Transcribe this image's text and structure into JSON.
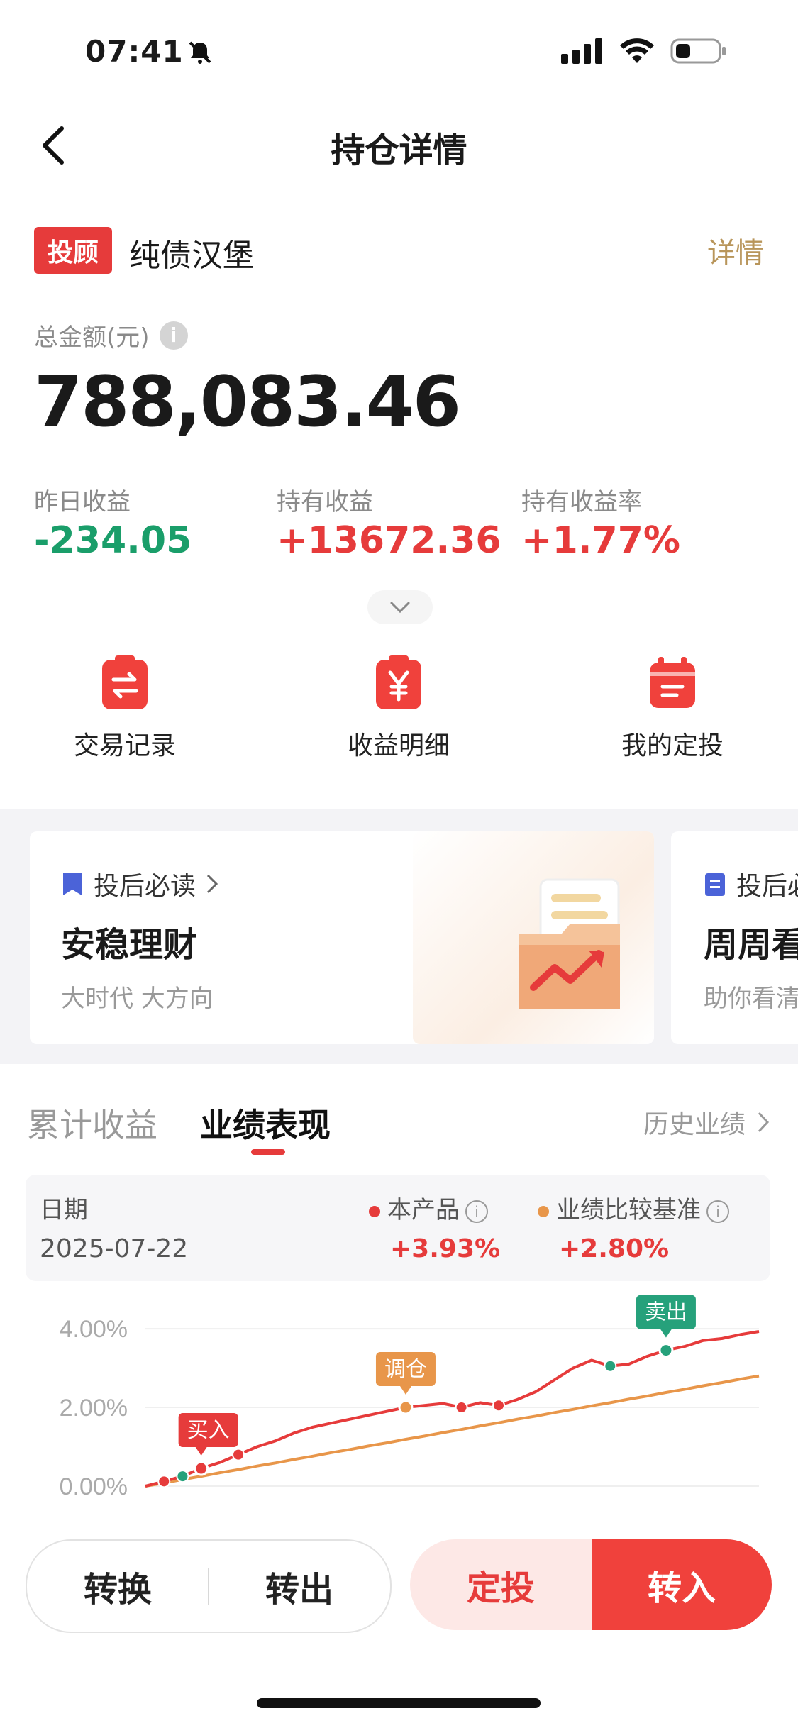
{
  "status_bar": {
    "time": "07:41"
  },
  "nav": {
    "title": "持仓详情"
  },
  "product": {
    "tag": "投顾",
    "name": "纯债汉堡",
    "detail_link": "详情"
  },
  "summary": {
    "total_label": "总金额(元)",
    "total_value": "788,083.46",
    "metrics": [
      {
        "label": "昨日收益",
        "value": "-234.05",
        "color": "#1a9e6a"
      },
      {
        "label": "持有收益",
        "value": "+13672.36",
        "color": "#e63b3b"
      },
      {
        "label": "持有收益率",
        "value": "+1.77%",
        "color": "#e63b3b"
      }
    ]
  },
  "quick_actions": [
    {
      "label": "交易记录",
      "icon": "exchange-icon"
    },
    {
      "label": "收益明细",
      "icon": "yuan-receipt-icon"
    },
    {
      "label": "我的定投",
      "icon": "calendar-icon"
    }
  ],
  "cards": [
    {
      "header": "投后必读",
      "title": "安稳理财",
      "subtitle": "大时代 大方向"
    },
    {
      "header": "投后必",
      "title": "周周看",
      "subtitle": "助你看清"
    }
  ],
  "performance": {
    "tabs": [
      "累计收益",
      "业绩表现"
    ],
    "active_tab": 1,
    "history_link": "历史业绩",
    "legend": {
      "date_label": "日期",
      "date_value": "2025-07-22",
      "product_label": "本产品",
      "product_value": "+3.93%",
      "benchmark_label": "业绩比较基准",
      "benchmark_value": "+2.80%"
    }
  },
  "chart_data": {
    "type": "line",
    "y_ticks": [
      "4.00%",
      "2.00%",
      "0.00%"
    ],
    "ylim": [
      0,
      4.2
    ],
    "series": [
      {
        "name": "本产品",
        "color": "#e63b3b",
        "values": [
          0.0,
          0.12,
          0.25,
          0.45,
          0.6,
          0.8,
          1.0,
          1.15,
          1.35,
          1.5,
          1.6,
          1.7,
          1.8,
          1.9,
          2.0,
          2.05,
          2.1,
          2.0,
          2.12,
          2.05,
          2.2,
          2.4,
          2.7,
          3.0,
          3.2,
          3.05,
          3.1,
          3.3,
          3.45,
          3.55,
          3.7,
          3.75,
          3.85,
          3.93
        ]
      },
      {
        "name": "业绩比较基准",
        "color": "#e8964a",
        "values": [
          0.0,
          0.08,
          0.17,
          0.25,
          0.34,
          0.42,
          0.51,
          0.59,
          0.68,
          0.76,
          0.85,
          0.93,
          1.02,
          1.1,
          1.19,
          1.27,
          1.36,
          1.44,
          1.53,
          1.61,
          1.7,
          1.78,
          1.87,
          1.95,
          2.04,
          2.12,
          2.21,
          2.29,
          2.38,
          2.46,
          2.55,
          2.63,
          2.72,
          2.8
        ]
      }
    ],
    "annotations": [
      {
        "label": "买入",
        "index": 3,
        "color": "#e63b3b"
      },
      {
        "label": "调仓",
        "index": 14,
        "color": "#e8964a"
      },
      {
        "label": "卖出",
        "index": 28,
        "color": "#26a17b"
      }
    ]
  },
  "actions": {
    "convert": "转换",
    "transfer_out": "转出",
    "auto_invest": "定投",
    "transfer_in": "转入"
  }
}
